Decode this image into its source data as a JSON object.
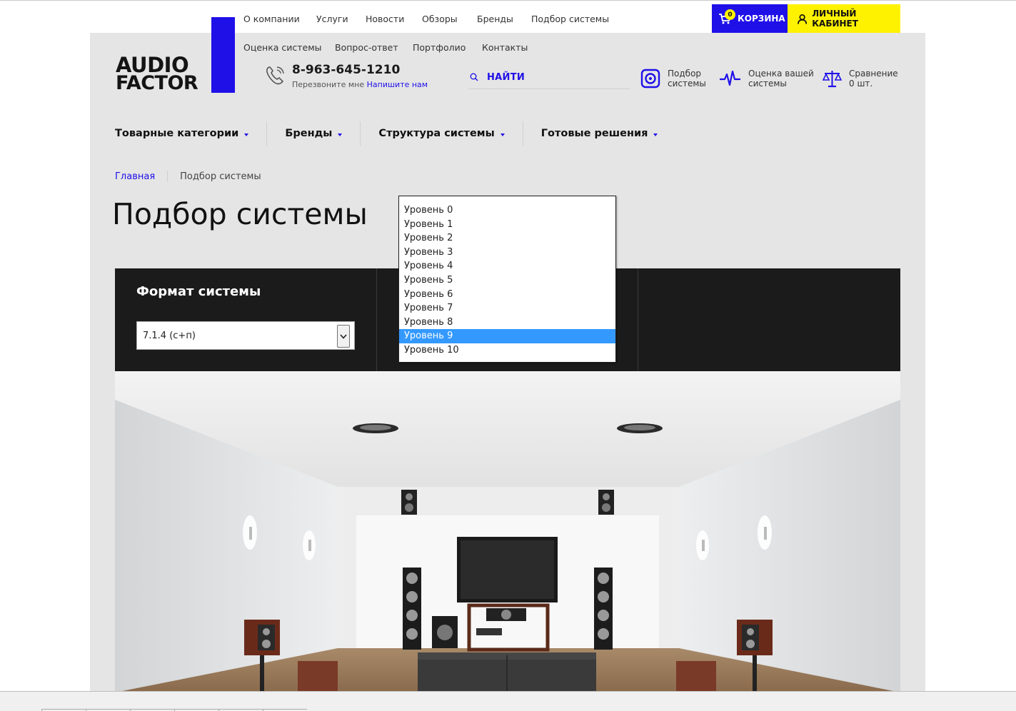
{
  "topnav": {
    "row1": [
      "О компании",
      "Услуги",
      "Новости",
      "Обзоры",
      "Бренды",
      "Подбор системы"
    ],
    "row2": [
      "Оценка системы",
      "Вопрос-ответ",
      "Портфолио",
      "Контакты"
    ]
  },
  "logo": {
    "line1": "AUDIO",
    "line2": "FACTOR"
  },
  "header": {
    "cart_label": "КОРЗИНА",
    "cart_count": "0",
    "cabinet_label": "ЛИЧНЫЙ КАБИНЕТ",
    "phone": "8-963-645-1210",
    "callback_text": "Перезвоните мне",
    "callback_link": "Напишите нам",
    "search_label": "НАЙТИ",
    "quick": [
      {
        "line1": "Подбор",
        "line2": "системы",
        "icon": "speaker-icon"
      },
      {
        "line1": "Оценка вашей",
        "line2": "системы",
        "icon": "pulse-icon"
      },
      {
        "line1": "Сравнение",
        "line2": "0 шт.",
        "icon": "scales-icon"
      }
    ]
  },
  "catnav": [
    "Товарные категории",
    "Бренды",
    "Структура системы",
    "Готовые решения"
  ],
  "breadcrumb": {
    "home": "Главная",
    "current": "Подбор системы"
  },
  "page_title": "Подбор системы",
  "panel": {
    "format_title": "Формат системы",
    "format_value": "7.1.4 (с+п)"
  },
  "dropdown": {
    "options": [
      "Уровень 0",
      "Уровень 1",
      "Уровень 2",
      "Уровень 3",
      "Уровень 4",
      "Уровень 5",
      "Уровень 6",
      "Уровень 7",
      "Уровень 8",
      "Уровень 9",
      "Уровень 10"
    ],
    "selected_index": 9
  },
  "colors": {
    "brand_blue": "#1f10e8",
    "accent_yellow": "#fff200",
    "panel_dark": "#1b1b1b",
    "highlight": "#3399ff"
  }
}
